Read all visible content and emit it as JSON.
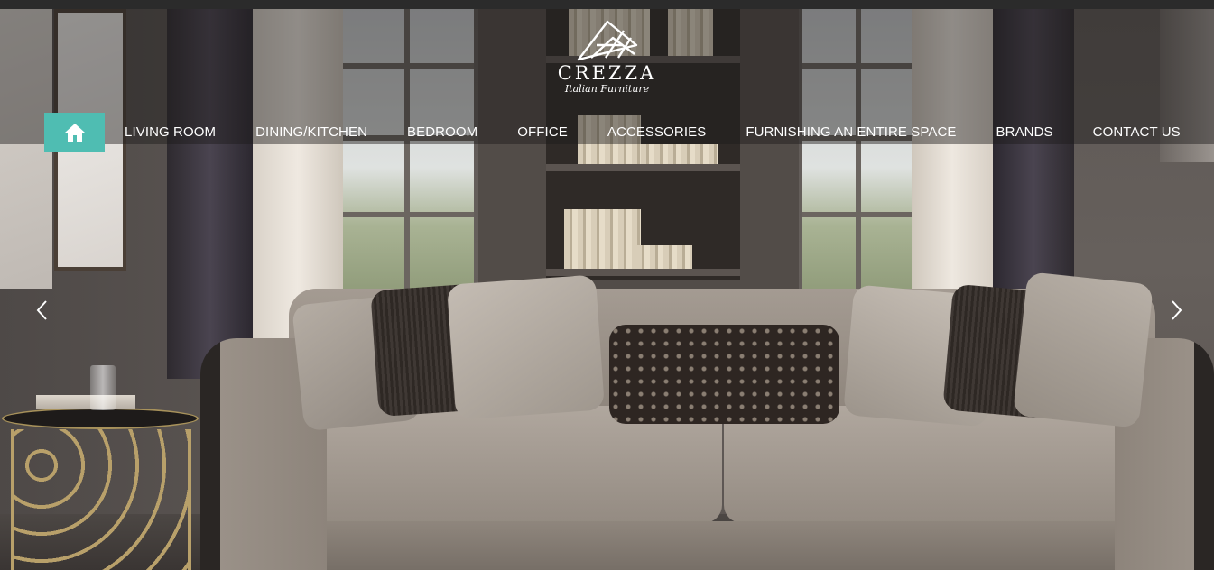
{
  "brand": {
    "name": "CREZZA",
    "tagline": "Italian Furniture",
    "logo_icon": "fan-icon"
  },
  "nav": {
    "home_icon": "home-icon",
    "accent_color": "#4fbdb2",
    "items": [
      {
        "label": "LIVING ROOM"
      },
      {
        "label": "DINING/KITCHEN"
      },
      {
        "label": "BEDROOM"
      },
      {
        "label": "OFFICE"
      },
      {
        "label": "ACCESSORIES"
      },
      {
        "label": "FURNISHING AN ENTIRE SPACE"
      },
      {
        "label": "BRANDS"
      },
      {
        "label": "CONTACT US"
      }
    ]
  },
  "slider": {
    "prev_icon": "chevron-left-icon",
    "next_icon": "chevron-right-icon"
  }
}
